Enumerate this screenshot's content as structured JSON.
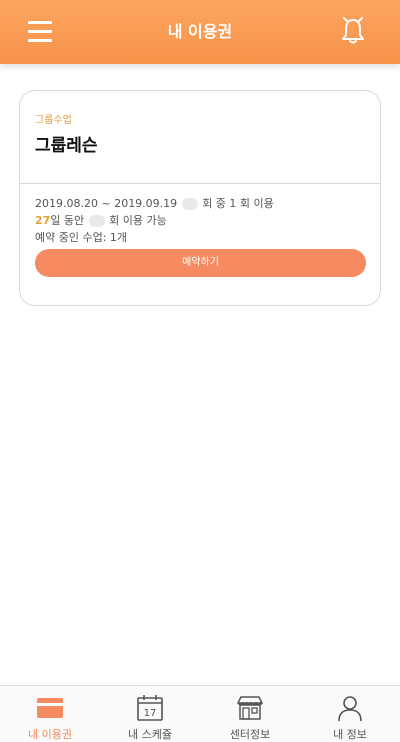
{
  "header": {
    "title": "내 이용권"
  },
  "card": {
    "category": "그룹수업",
    "name": "그룹레슨",
    "period_prefix": "2019.08.20 ~ 2019.09.19",
    "period_suffix": "회 중 1 회 이용",
    "days_value": "27",
    "days_mid": "일 동안",
    "days_suffix": "회 이용 가능",
    "reservation_text": "예약 중인 수업: 1개",
    "reserve_label": "예약하기"
  },
  "tabbar": {
    "items": [
      {
        "label": "내 이용권",
        "icon": "card-icon"
      },
      {
        "label": "내 스케쥴",
        "icon": "calendar-icon",
        "calendar_day": "17"
      },
      {
        "label": "센터정보",
        "icon": "store-icon"
      },
      {
        "label": "내 정보",
        "icon": "person-icon"
      }
    ]
  },
  "colors": {
    "header": "#f7924a",
    "accent": "#f68a60",
    "days_highlight": "#e8a031"
  }
}
